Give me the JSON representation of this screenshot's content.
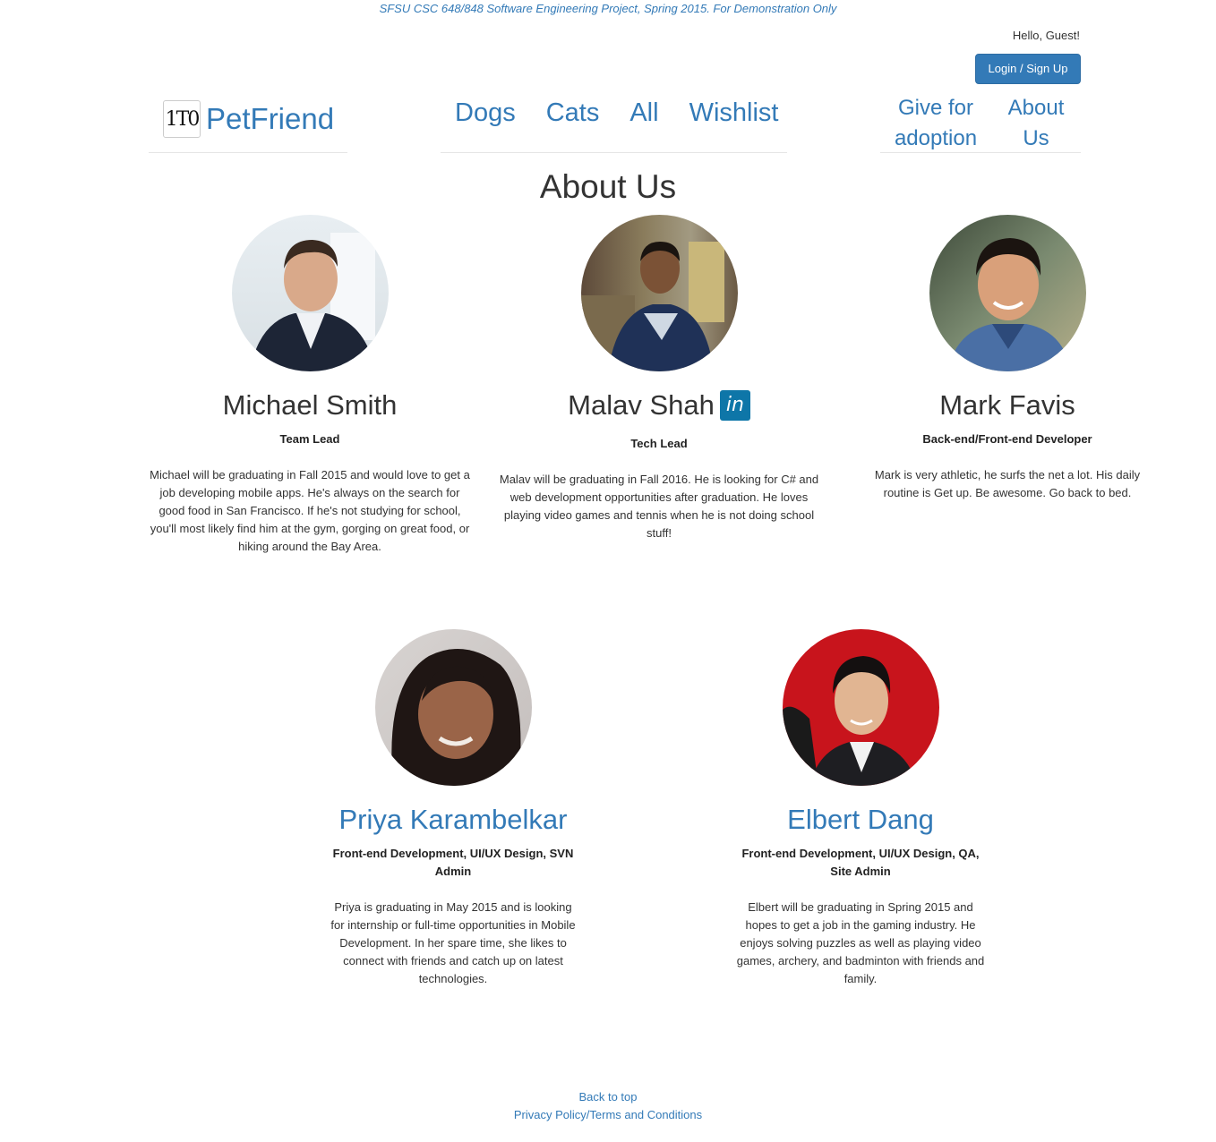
{
  "banner": "SFSU CSC 648/848 Software Engineering Project, Spring 2015. For Demonstration Only",
  "header": {
    "greeting": "Hello, Guest!",
    "login_label": "Login / Sign Up",
    "brand_logo_text": "1T0",
    "brand_name": "PetFriend",
    "nav": [
      "Dogs",
      "Cats",
      "All",
      "Wishlist"
    ],
    "side_nav": {
      "give_line1": "Give for",
      "give_line2": "adoption",
      "about_line1": "About",
      "about_line2": "Us"
    }
  },
  "page_title": "About Us",
  "members": [
    {
      "name": "Michael Smith",
      "role": "Team Lead",
      "bio": "Michael will be graduating in Fall 2015 and would love to get a job developing mobile apps. He's always on the search for good food in San Francisco. If he's not studying for school, you'll most likely find him at the gym, gorging on great food, or hiking around the Bay Area."
    },
    {
      "name": "Malav Shah",
      "linkedin": "in",
      "role": "Tech Lead",
      "bio": "Malav will be graduating in Fall 2016. He is looking for C# and web development opportunities after graduation. He loves playing video games and tennis when he is not doing school stuff!"
    },
    {
      "name": "Mark Favis",
      "role": "Back-end/Front-end Developer",
      "bio": "Mark is very athletic, he surfs the net a lot. His daily routine is Get up. Be awesome. Go back to bed."
    },
    {
      "name": "Priya Karambelkar",
      "role": "Front-end Development, UI/UX Design, SVN Admin",
      "bio": "Priya is graduating in May 2015 and is looking for internship or full-time opportunities in Mobile Development. In her spare time, she likes to connect with friends and catch up on latest technologies."
    },
    {
      "name": "Elbert Dang",
      "role": "Front-end Development, UI/UX Design, QA, Site Admin",
      "bio": "Elbert will be graduating in Spring 2015 and hopes to get a job in the gaming industry. He enjoys solving puzzles as well as playing video games, archery, and badminton with friends and family."
    }
  ],
  "footer": {
    "back_to_top": "Back to top",
    "privacy": "Privacy Policy/Terms and Conditions"
  }
}
